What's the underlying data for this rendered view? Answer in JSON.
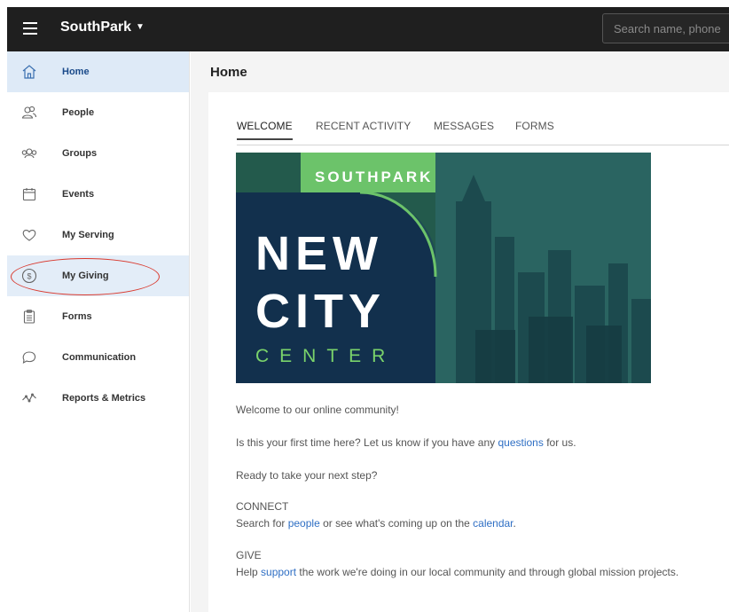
{
  "topbar": {
    "brand": "SouthPark",
    "search_placeholder": "Search name, phone or email"
  },
  "sidebar": {
    "items": [
      {
        "label": "Home",
        "icon": "home-icon"
      },
      {
        "label": "People",
        "icon": "people-icon"
      },
      {
        "label": "Groups",
        "icon": "groups-icon"
      },
      {
        "label": "Events",
        "icon": "calendar-icon"
      },
      {
        "label": "My Serving",
        "icon": "heart-icon"
      },
      {
        "label": "My Giving",
        "icon": "dollar-icon"
      },
      {
        "label": "Forms",
        "icon": "clipboard-icon"
      },
      {
        "label": "Communication",
        "icon": "chat-icon"
      },
      {
        "label": "Reports & Metrics",
        "icon": "chart-line-icon"
      }
    ]
  },
  "main": {
    "title": "Home",
    "tabs": [
      "WELCOME",
      "RECENT ACTIVITY",
      "MESSAGES",
      "FORMS"
    ],
    "banner": {
      "top": "SOUTHPARK",
      "line1": "NEW",
      "line2": "CITY",
      "line3": "CENTER"
    },
    "content": {
      "welcome": "Welcome to our online community!",
      "first_time_pre": "Is this your first time here? Let us know if you have any ",
      "first_time_link": "questions",
      "first_time_post": " for us.",
      "next_step": "Ready to take your next step?",
      "connect_heading": "CONNECT",
      "connect_pre": "Search for ",
      "connect_link1": "people",
      "connect_mid": " or see what's coming up on the ",
      "connect_link2": "calendar",
      "connect_post": ".",
      "give_heading": "GIVE",
      "give_pre": "Help ",
      "give_link": "support",
      "give_post": " the work we're doing in our local community and through global mission projects."
    }
  },
  "colors": {
    "topbar": "#1f1f1f",
    "active_nav": "#deeaf7",
    "link": "#2f6fc4",
    "annotation": "#d93a2f",
    "banner_green": "#6cc36a",
    "banner_navy": "#12304d"
  }
}
